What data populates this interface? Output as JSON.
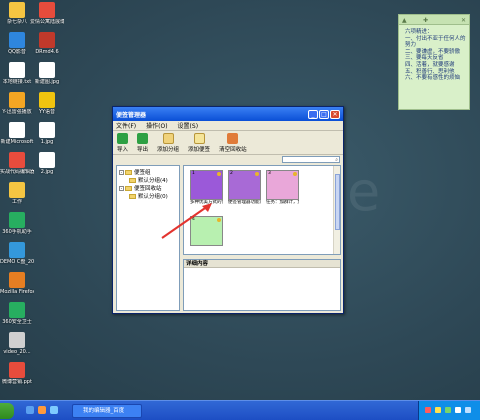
{
  "desktop_icons": [
    {
      "label": "杂七杂八",
      "color": "#f5c542"
    },
    {
      "label": "QQ影音",
      "color": "#2e86de"
    },
    {
      "label": "本地链接.txt",
      "color": "#ffffff"
    },
    {
      "label": "Y-迅雷强播放",
      "color": "#f5a623"
    },
    {
      "label": "新建Microsoft",
      "color": "#ffffff"
    },
    {
      "label": "实战代码编辑器sym",
      "color": "#e84c3d"
    },
    {
      "label": "工作",
      "color": "#f5c542"
    },
    {
      "label": "360手机助手",
      "color": "#27ae60"
    },
    {
      "label": "DEMO C盘_20150...",
      "color": "#3498db"
    },
    {
      "label": "Mozilla Firefox",
      "color": "#e67e22"
    },
    {
      "label": "360安全卫士",
      "color": "#27ae60"
    },
    {
      "label": "video_20...",
      "color": "#d0d0d0"
    },
    {
      "label": "微博营销.ppt",
      "color": "#e74c3c"
    },
    {
      "label": "爱情公寓陆展博萌宝",
      "color": "#e74c3c"
    },
    {
      "label": "DRmd4.6",
      "color": "#c0392b"
    },
    {
      "label": "新建图.jpg",
      "color": "#ffffff"
    },
    {
      "label": "YY语音",
      "color": "#f1c40f"
    },
    {
      "label": "1.jpg",
      "color": "#ffffff"
    },
    {
      "label": "2.jpg",
      "color": "#ffffff"
    }
  ],
  "sticky_note": {
    "lines": [
      "六项精进：",
      "一、付出不亚于任何人的",
      "努力",
      "二、要谦虚，不要骄傲",
      "三、要每天反省",
      "四、活着，就要感谢",
      "五、积善行、思利他",
      "六、不要有感性的烦恼"
    ]
  },
  "window": {
    "title": "便签管理器",
    "menu": [
      "文件(F)",
      "操作(O)",
      "设置(S)"
    ],
    "toolbar": [
      "导入",
      "导出",
      "添加分组",
      "添加便签",
      "清空回收站"
    ],
    "tree": [
      {
        "label": "便签组",
        "level": 0,
        "expander": "-"
      },
      {
        "label": "默认分组(4)",
        "level": 1,
        "expander": ""
      },
      {
        "label": "便签回收站",
        "level": 0,
        "expander": "-"
      },
      {
        "label": "默认分组(0)",
        "level": 1,
        "expander": ""
      }
    ],
    "notes": [
      {
        "num": "1",
        "caption": "多种优美方式的便捷回  Ente...",
        "color": "#9b59d9"
      },
      {
        "num": "2",
        "caption": "便签管理器功能简介：1.便...",
        "color": "#a86ad6"
      },
      {
        "num": "3",
        "caption": "任务：加群计，加关于什么...",
        "color": "#e9a7d9"
      },
      {
        "num": "4",
        "caption": "",
        "color": "#b8f0b0"
      }
    ],
    "detail_header": "详细内容"
  },
  "taskbar": {
    "task_label": "我的编辑器_百度",
    "tray_colors": [
      "#ff5d5d",
      "#ffe14d",
      "#7ad36b",
      "#ffffff",
      "#c0e0ff"
    ]
  },
  "watermark": "le"
}
